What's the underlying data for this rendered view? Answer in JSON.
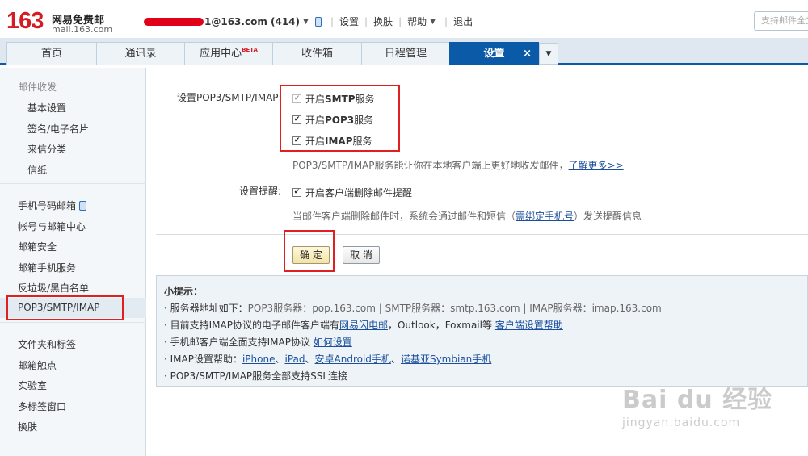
{
  "header": {
    "logo_number": "163",
    "logo_name": "网易免费邮",
    "logo_domain": "mail.163.com",
    "account_email": "1@163.com (414)",
    "links": [
      "设置",
      "换肤",
      "帮助",
      "退出"
    ],
    "search_placeholder": "支持邮件全文"
  },
  "tabs": [
    {
      "label": "首页"
    },
    {
      "label": "通讯录"
    },
    {
      "label": "应用中心",
      "badge": "BETA"
    },
    {
      "label": "收件箱"
    },
    {
      "label": "日程管理"
    },
    {
      "label": "设置",
      "active": true,
      "close": "×"
    }
  ],
  "sidebar": {
    "group1_title": "邮件收发",
    "group1": [
      "基本设置",
      "签名/电子名片",
      "来信分类",
      "信纸"
    ],
    "group2": [
      "手机号码邮箱",
      "帐号与邮箱中心",
      "邮箱安全",
      "邮箱手机服务",
      "反垃圾/黑白名单",
      "POP3/SMTP/IMAP"
    ],
    "group3": [
      "文件夹和标签",
      "邮箱触点",
      "实验室",
      "多标签窗口",
      "换肤"
    ]
  },
  "form": {
    "pop_label": "设置POP3/SMTP/IMAP:",
    "smtp_label_prefix": "开启",
    "smtp_label_strong": "SMTP",
    "smtp_label_suffix": "服务",
    "pop3_label_prefix": "开启",
    "pop3_label_strong": "POP3",
    "pop3_label_suffix": "服务",
    "imap_label_prefix": "开启",
    "imap_label_strong": "IMAP",
    "imap_label_suffix": "服务",
    "pop_hint": "POP3/SMTP/IMAP服务能让你在本地客户端上更好地收发邮件，",
    "pop_hint_link": "了解更多>>",
    "remind_label": "设置提醒:",
    "remind_checkbox": "开启客户端删除邮件提醒",
    "remind_hint_prefix": "当邮件客户端删除邮件时，系统会通过邮件和短信（",
    "remind_hint_link": "需绑定手机号",
    "remind_hint_suffix": "）发送提醒信息",
    "ok_button": "确 定",
    "cancel_button": "取 消"
  },
  "tips": {
    "title": "小提示：",
    "line1_prefix": "· 服务器地址如下：",
    "line1_servers": "POP3服务器：pop.163.com  |  SMTP服务器：smtp.163.com  |  IMAP服务器：imap.163.com",
    "line2_prefix": "· 目前支持IMAP协议的电子邮件客户端有",
    "line2_link1": "网易闪电邮",
    "line2_mid": "，Outlook，Foxmail等",
    "line2_link2": "客户端设置帮助",
    "line3_prefix": "· 手机邮客户端全面支持IMAP协议",
    "line3_link": "如何设置",
    "line4_prefix": "· IMAP设置帮助：",
    "line4_link1": "iPhone",
    "line4_link2": "iPad",
    "line4_link3": "安卓Android手机",
    "line4_link4": "诺基亚Symbian手机",
    "line4_sep": "、",
    "line5": "· POP3/SMTP/IMAP服务全部支持SSL连接"
  },
  "watermark": {
    "brand": "Bai du 经验",
    "url": "jingyan.baidu.com"
  },
  "colors": {
    "brand_red": "#d51b24",
    "tab_active": "#0a5aa8",
    "link": "#1a4f9c",
    "highlight_box": "#e02020"
  }
}
